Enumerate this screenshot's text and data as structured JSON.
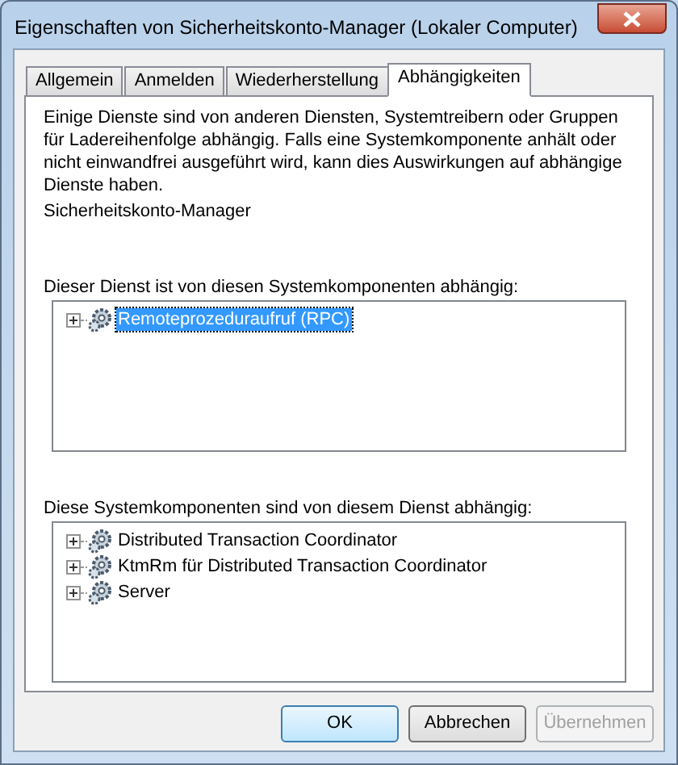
{
  "window": {
    "title": "Eigenschaften von Sicherheitskonto-Manager (Lokaler Computer)"
  },
  "tabs": [
    {
      "label": "Allgemein",
      "selected": false
    },
    {
      "label": "Anmelden",
      "selected": false
    },
    {
      "label": "Wiederherstellung",
      "selected": false
    },
    {
      "label": "Abhängigkeiten",
      "selected": true
    }
  ],
  "description": "Einige Dienste sind von anderen Diensten, Systemtreibern oder Gruppen für Ladereihenfolge abhängig. Falls eine Systemkomponente anhält oder nicht einwandfrei ausgeführt wird, kann dies Auswirkungen auf abhängige Dienste haben.",
  "service_name": "Sicherheitskonto-Manager",
  "depends_on": {
    "label": "Dieser Dienst ist von diesen Systemkomponenten abhängig:",
    "items": [
      {
        "label": "Remoteprozeduraufruf (RPC)",
        "selected": true,
        "expanded": false
      }
    ]
  },
  "dependents": {
    "label": "Diese Systemkomponenten sind von diesem Dienst abhängig:",
    "items": [
      {
        "label": "Distributed Transaction Coordinator",
        "selected": false,
        "expanded": false
      },
      {
        "label": "KtmRm für Distributed Transaction Coordinator",
        "selected": false,
        "expanded": false
      },
      {
        "label": "Server",
        "selected": false,
        "expanded": false
      }
    ]
  },
  "buttons": [
    {
      "label": "OK",
      "default": true,
      "disabled": false
    },
    {
      "label": "Abbrechen",
      "default": false,
      "disabled": false
    },
    {
      "label": "Übernehmen",
      "default": false,
      "disabled": true
    }
  ]
}
